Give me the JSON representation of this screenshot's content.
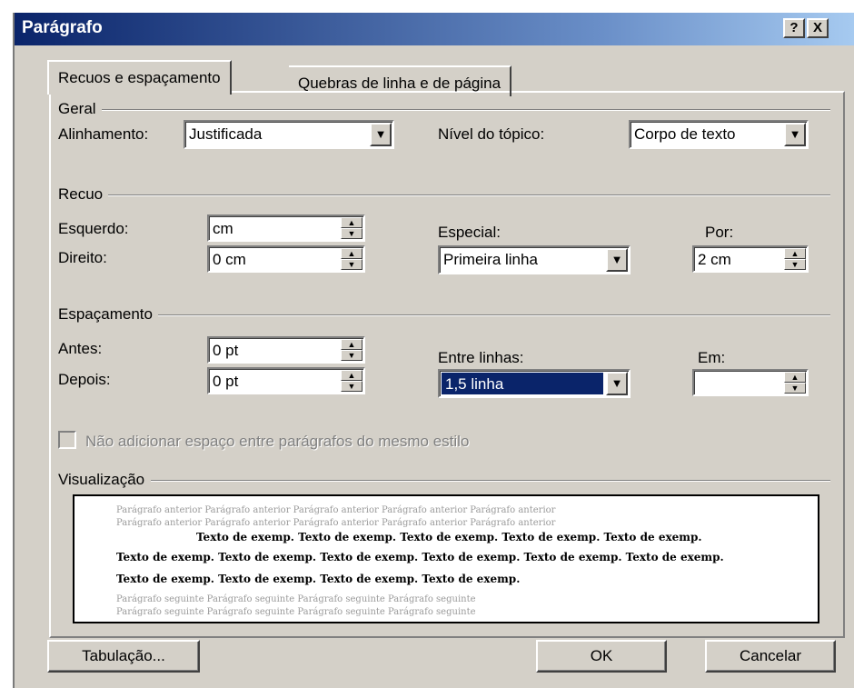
{
  "window": {
    "title": "Parágrafo",
    "help_label": "?",
    "close_label": "X"
  },
  "tabs": [
    {
      "label": "Recuos e espaçamento"
    },
    {
      "label": "Quebras de linha e de página"
    }
  ],
  "geral": {
    "group_label": "Geral",
    "alinhamento_label": "Alinhamento:",
    "alinhamento_value": "Justificada",
    "nivel_label": "Nível do tópico:",
    "nivel_value": "Corpo de texto"
  },
  "recuo": {
    "group_label": "Recuo",
    "esquerdo_label": "Esquerdo:",
    "esquerdo_value": "cm",
    "direito_label": "Direito:",
    "direito_value": "0 cm",
    "especial_label": "Especial:",
    "especial_value": "Primeira linha",
    "por_label": "Por:",
    "por_value": "2 cm"
  },
  "espacamento": {
    "group_label": "Espaçamento",
    "antes_label": "Antes:",
    "antes_value": "0 pt",
    "depois_label": "Depois:",
    "depois_value": "0 pt",
    "entre_label": "Entre linhas:",
    "entre_value": "1,5 linha",
    "em_label": "Em:",
    "em_value": ""
  },
  "checkbox_label": "Não adicionar espaço entre parágrafos do mesmo estilo",
  "preview": {
    "group_label": "Visualização",
    "prev_line_1": "Parágrafo anterior Parágrafo anterior Parágrafo anterior Parágrafo anterior Parágrafo anterior",
    "prev_line_2": "Parágrafo anterior Parágrafo anterior Parágrafo anterior Parágrafo anterior Parágrafo anterior",
    "sample_line_1": "Texto de exemp. Texto de exemp. Texto de exemp. Texto de exemp. Texto de exemp.",
    "sample_line_2": "Texto de exemp. Texto de exemp. Texto de exemp. Texto de exemp. Texto de exemp. Texto de exemp.",
    "sample_line_3": "Texto de exemp. Texto de exemp. Texto de exemp. Texto de exemp.",
    "next_line_1": "Parágrafo seguinte Parágrafo seguinte Parágrafo seguinte Parágrafo seguinte",
    "next_line_2": "Parágrafo seguinte Parágrafo seguinte Parágrafo seguinte Parágrafo seguinte"
  },
  "buttons": {
    "tabulacao": "Tabulação...",
    "ok": "OK",
    "cancelar": "Cancelar"
  },
  "colors": {
    "title_start": "#0a246a",
    "title_end": "#a6caf0",
    "face": "#d4d0c8",
    "selection": "#0a246a"
  }
}
